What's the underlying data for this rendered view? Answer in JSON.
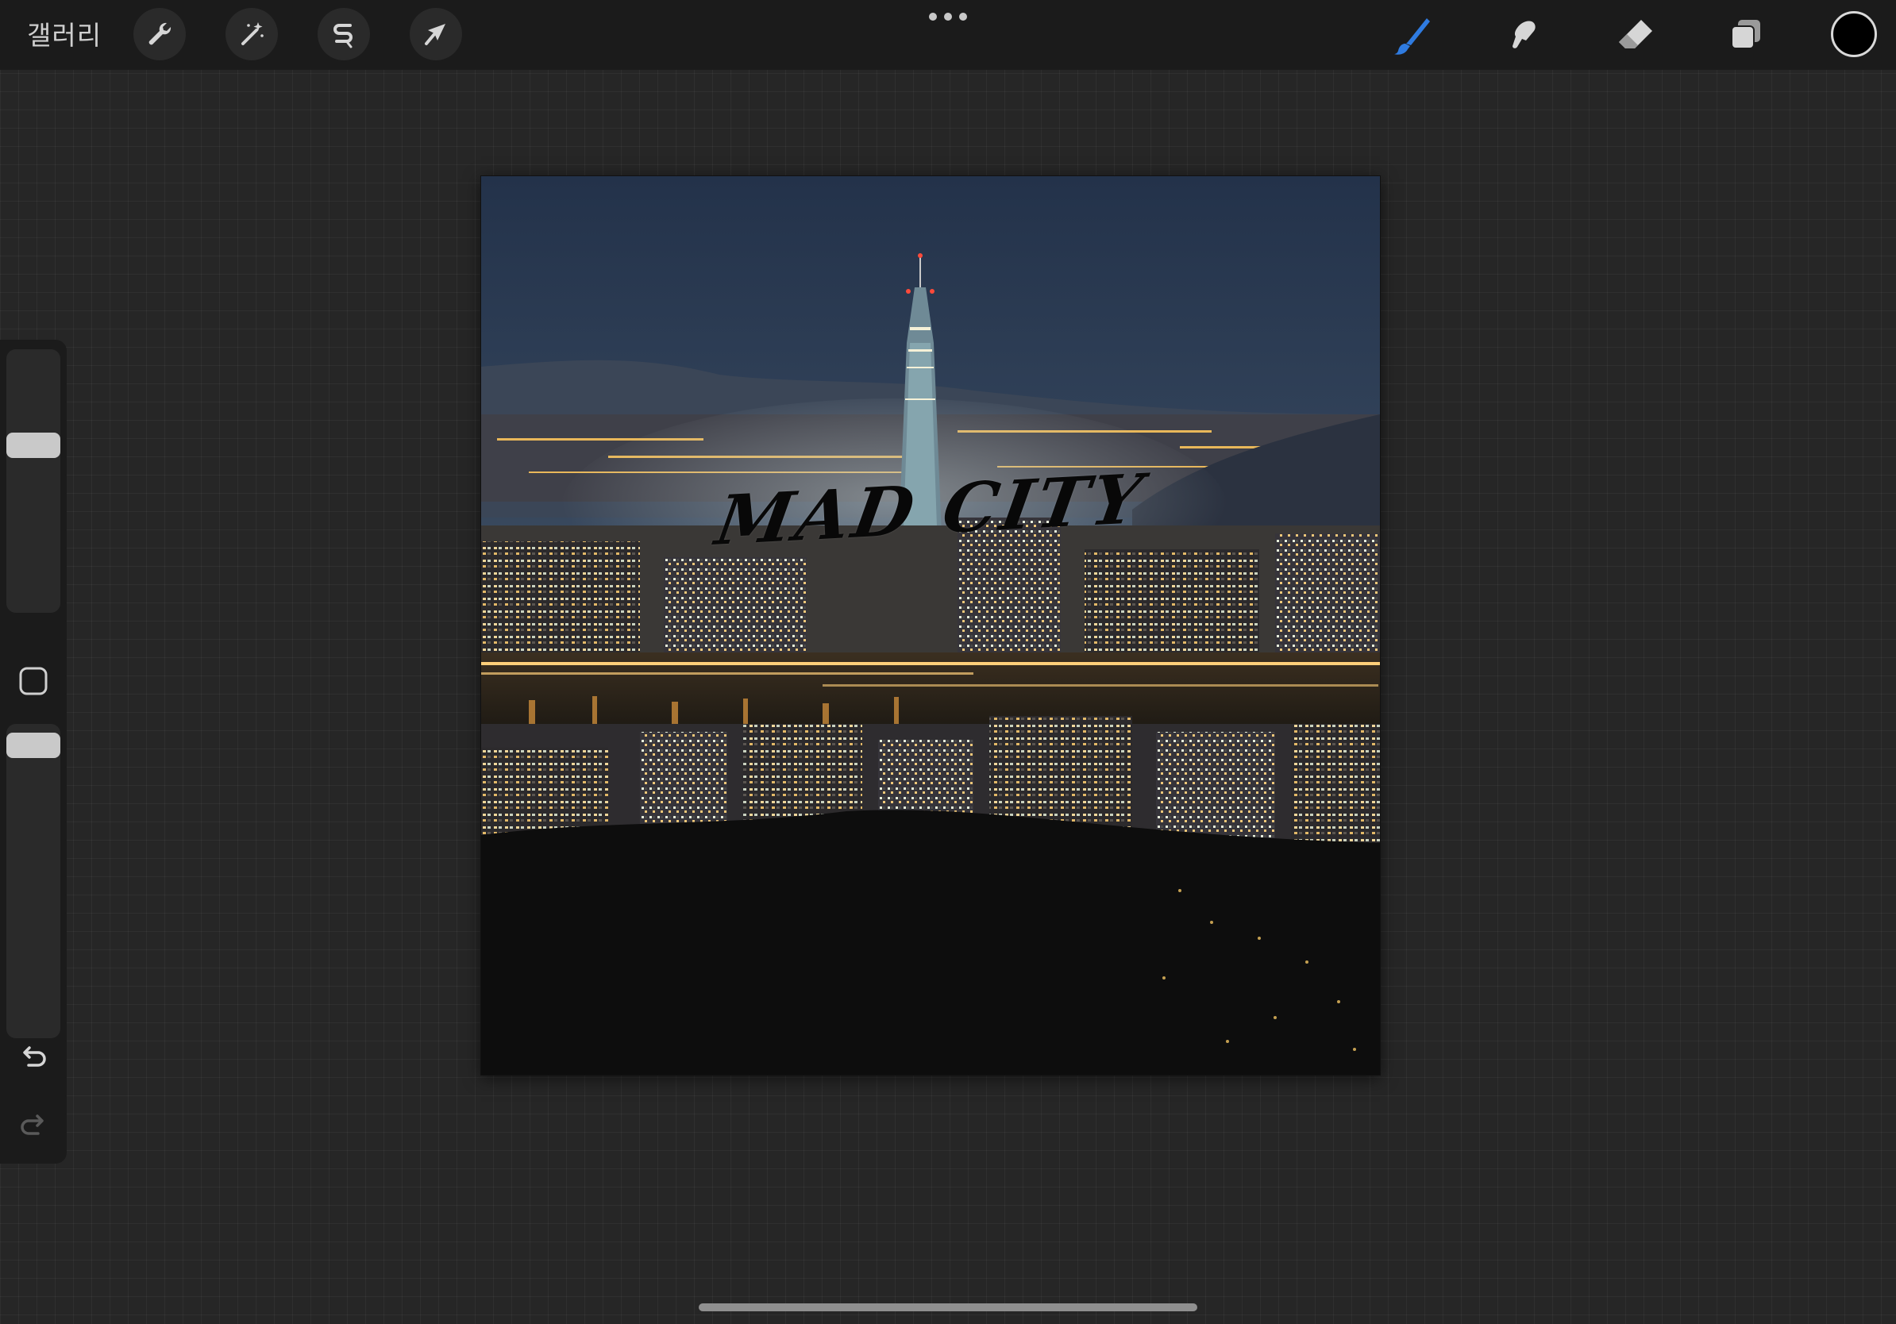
{
  "topbar": {
    "gallery_label": "갤러리",
    "left_tools": [
      "wrench-icon",
      "magic-wand-icon",
      "selection-s-icon",
      "transform-arrow-icon"
    ],
    "right_tools": [
      "brush-icon",
      "smudge-icon",
      "eraser-icon",
      "layers-icon"
    ],
    "active_tool": "brush",
    "accent_color": "#2f7be0",
    "current_color": "#000000"
  },
  "sidebar": {
    "brush_size_level": 0.65,
    "opacity_level": 0.97
  },
  "canvas": {
    "title_text": "MAD CITY"
  }
}
